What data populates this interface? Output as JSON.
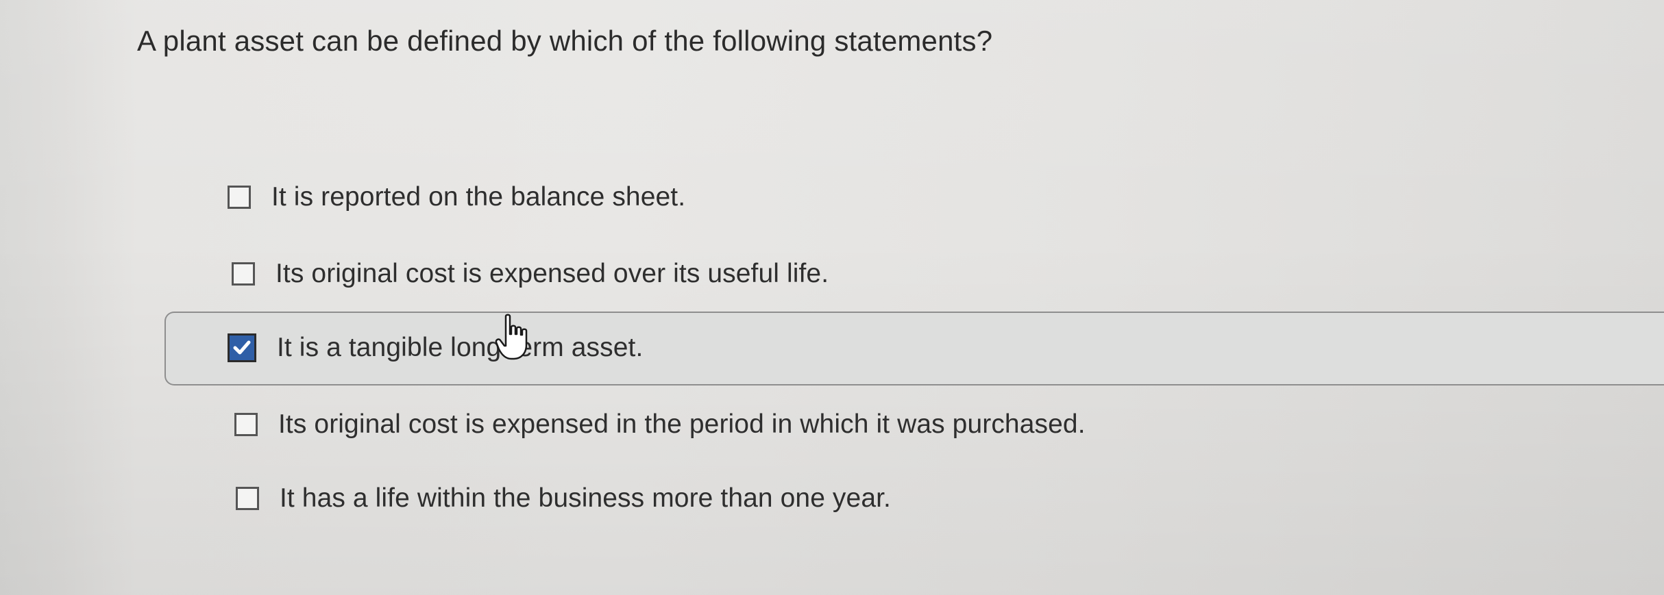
{
  "question": {
    "text": "A plant asset can be defined by which of the following statements?"
  },
  "choices": [
    {
      "label": "It is reported on the balance sheet.",
      "checked": false
    },
    {
      "label": "Its original cost is expensed over its useful life.",
      "checked": false
    },
    {
      "label": "It is a tangible long-term asset.",
      "checked": true
    },
    {
      "label": "Its original cost is expensed in the period in which it was purchased.",
      "checked": false
    },
    {
      "label": "It has a life within the business more than one year.",
      "checked": false
    }
  ],
  "colors": {
    "checkbox_checked": "#2f5fa7",
    "selected_row_bg": "#dddedd"
  },
  "icons": {
    "checkmark": "checkmark-icon",
    "cursor": "hand-pointer-cursor-icon"
  }
}
